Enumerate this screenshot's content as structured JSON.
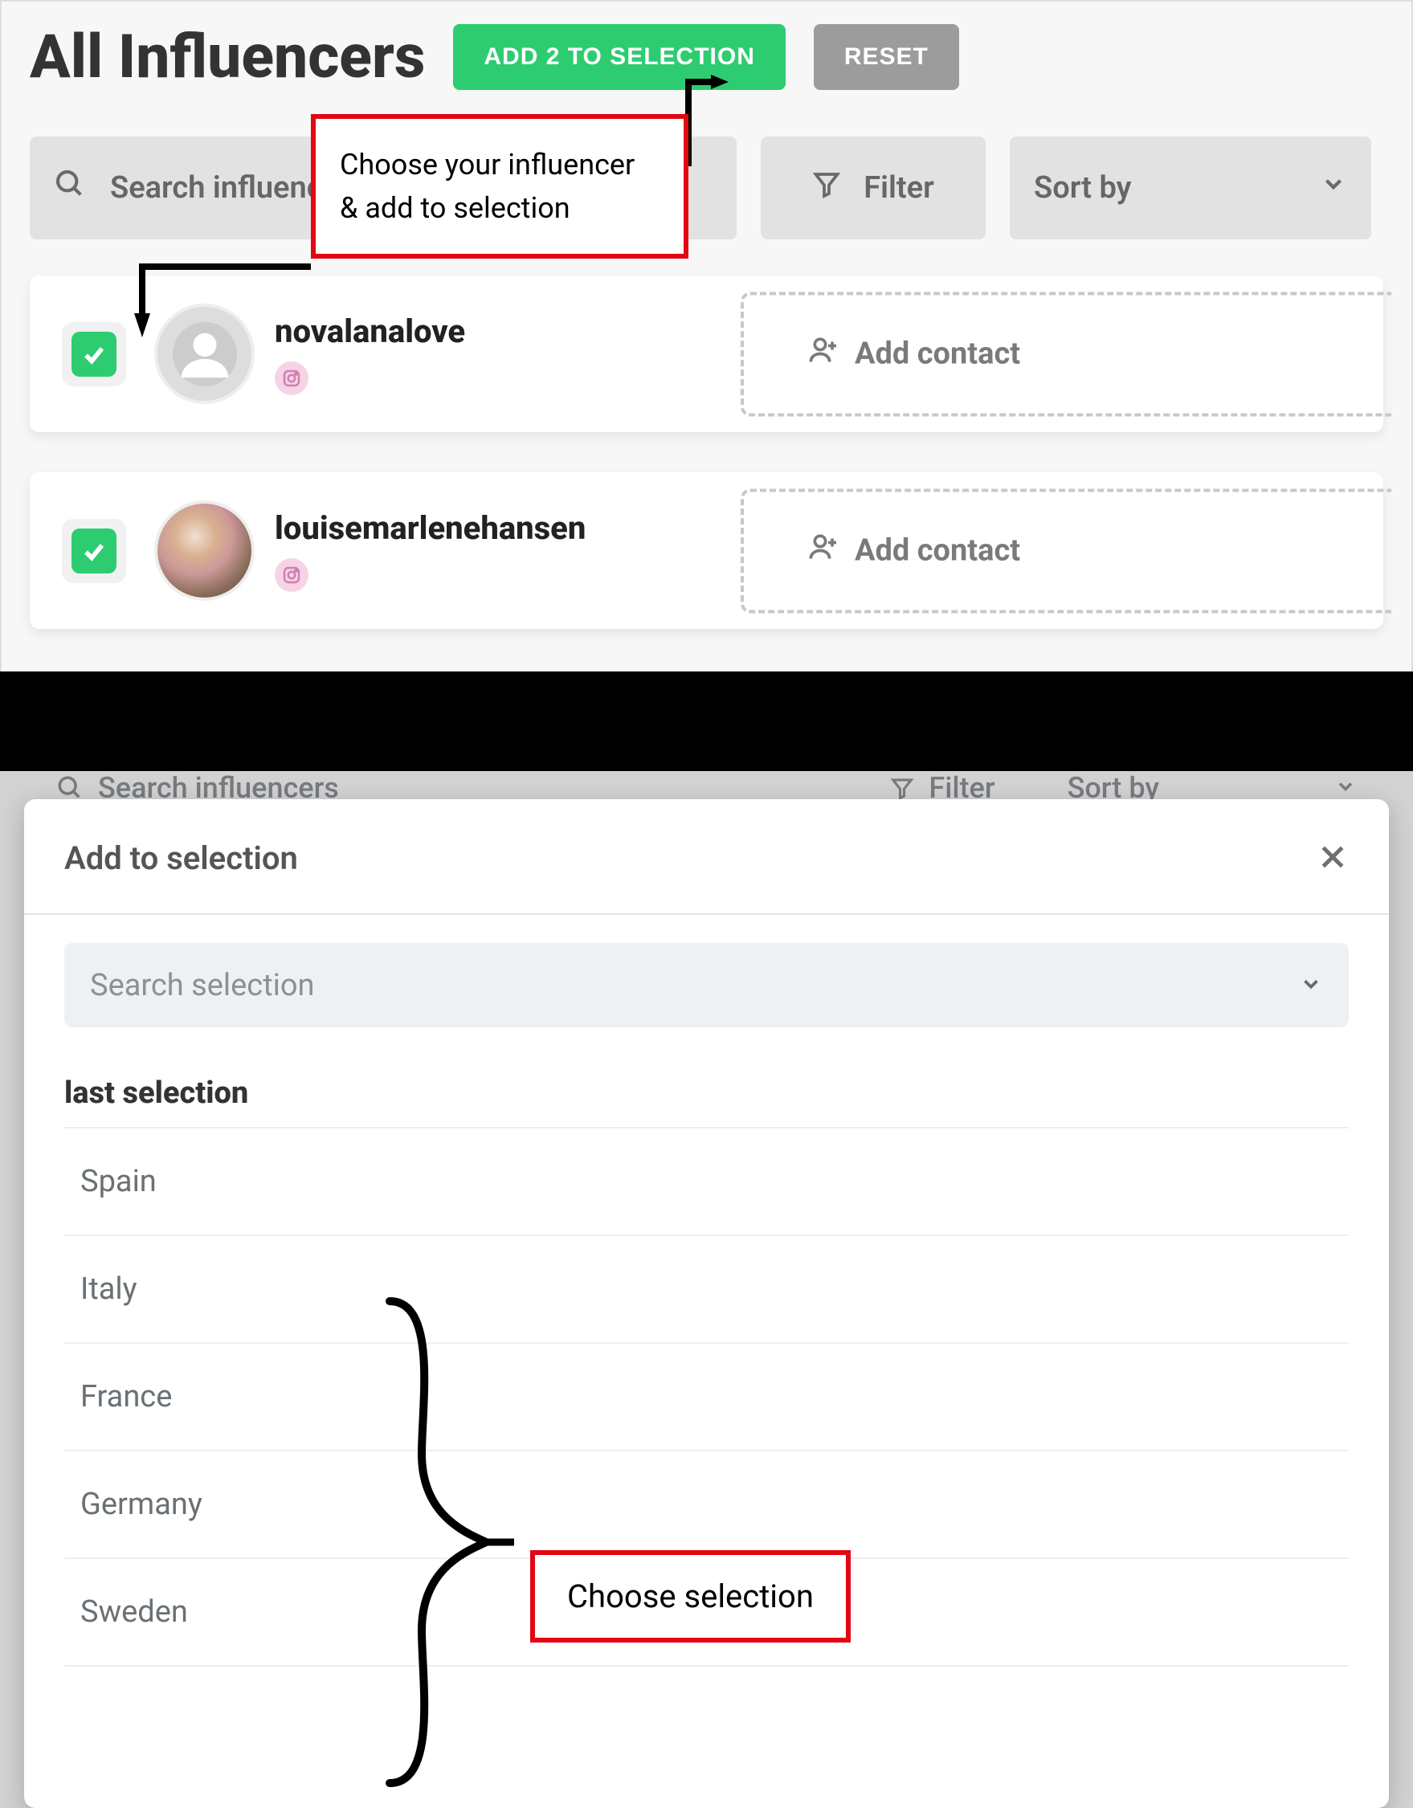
{
  "top": {
    "title": "All Influencers",
    "add_button": "ADD 2 TO SELECTION",
    "reset_button": "RESET",
    "search_placeholder": "Search influencers",
    "filter_label": "Filter",
    "sort_label": "Sort by",
    "callout_text": "Choose your influencer & add to selection",
    "influencers": [
      {
        "username": "novalanalove",
        "add_contact": "Add contact",
        "has_photo": false
      },
      {
        "username": "louisemarlenehansen",
        "add_contact": "Add contact",
        "has_photo": true
      }
    ]
  },
  "bg": {
    "search": "Search influencers",
    "filter": "Filter",
    "sort": "Sort by"
  },
  "modal": {
    "title": "Add to selection",
    "search_placeholder": "Search selection",
    "last_selection_heading": "last selection",
    "items": [
      "Spain",
      "Italy",
      "France",
      "Germany",
      "Sweden"
    ],
    "callout_text": "Choose selection"
  }
}
